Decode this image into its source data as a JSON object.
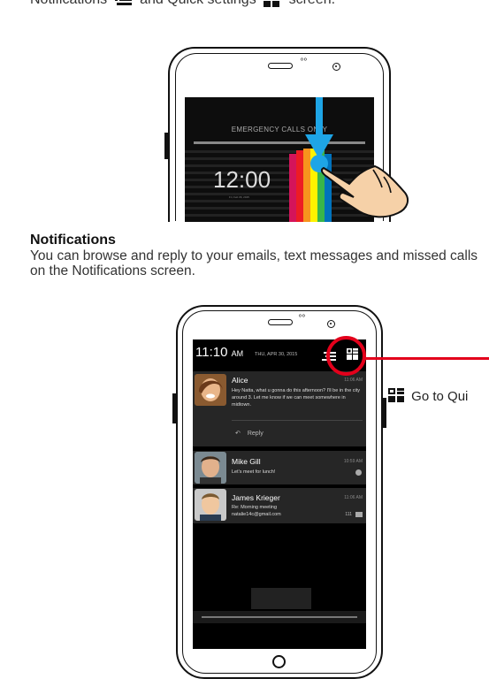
{
  "intro": {
    "prefix": "Notifications",
    "middle": "and Quick settings",
    "suffix": "screen."
  },
  "lock_screen": {
    "emergency_text": "EMERGENCY CALLS ONLY",
    "clock": "12:00",
    "date": "Fri, Feb 06, 2015"
  },
  "section": {
    "heading": "Notifications",
    "body": "You can browse and reply to your emails, text messages and missed calls on the Notifications screen."
  },
  "notif_screen": {
    "time": "11:10",
    "ampm": "AM",
    "date": "THU, APR 30, 2015",
    "notifications": [
      {
        "name": "Alice",
        "message": "Hey Natta, what u gonna do this afternoon? I'll be in the city around 3. Let me know if we can meet somewhere in midtown.",
        "time": "11:06 AM",
        "reply_label": "Reply"
      },
      {
        "name": "Mike Gill",
        "message": "Let's meet for lunch!",
        "time": "10:59 AM"
      },
      {
        "name": "James Krieger",
        "message": "Re: Morning meeting",
        "email": "natalie14c@gmail.com",
        "time": "11:06 AM",
        "count": "111"
      }
    ]
  },
  "callout": {
    "label": "Go to Qui"
  },
  "colors": {
    "accent_red": "#e3001b",
    "arrow_blue": "#1ea5e6",
    "skin": "#f6d1a8"
  }
}
